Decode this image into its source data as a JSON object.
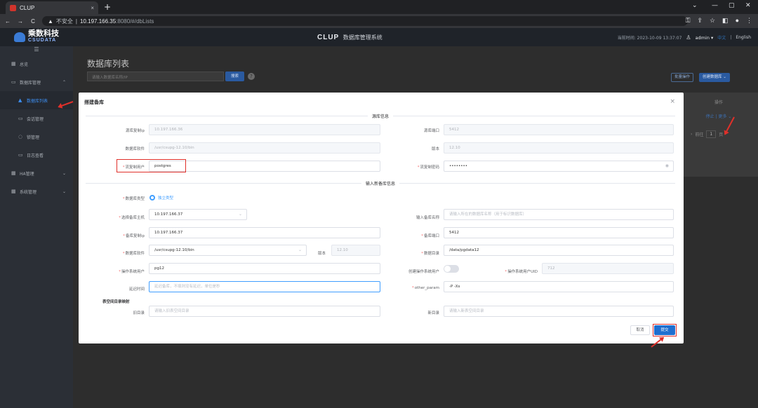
{
  "browser": {
    "tab_title": "CLUP",
    "tab_close": "×",
    "new_tab": "+",
    "back": "←",
    "forward": "→",
    "reload": "C",
    "insecure_label": "不安全",
    "url_host": "10.197.166.35",
    "url_rest": ":8080/#/dbLists",
    "window_controls": [
      "⌄",
      "—",
      "▢",
      "✕"
    ]
  },
  "header": {
    "logo_cn": "乘数科技",
    "logo_en": "CSUDATA",
    "brand": "CLUP",
    "app_title": "数据库管理系统",
    "time": "当前时间: 2023-10-09 13:37:07",
    "user": "admin ▾",
    "lang_cn": "中文",
    "lang_sep": "|",
    "lang_en": "English"
  },
  "sidebar": {
    "collapse": "☰",
    "items": [
      {
        "label": "总览",
        "icon": "▦"
      },
      {
        "label": "数据库管理",
        "icon": "▭",
        "chev": "⌃"
      },
      {
        "label": "数据库列表",
        "icon": "▲"
      },
      {
        "label": "会话管理",
        "icon": "▭"
      },
      {
        "label": "锁管理",
        "icon": "◌"
      },
      {
        "label": "日志查看",
        "icon": "▭"
      },
      {
        "label": "HA管理",
        "icon": "▦",
        "chev": "⌄"
      },
      {
        "label": "系统管理",
        "icon": "▦",
        "chev": "⌄"
      }
    ]
  },
  "page": {
    "title": "数据库列表",
    "search_placeholder": "请输入数据库名称/IP",
    "search_btn": "搜索",
    "help": "?",
    "batch_btn": "批量操作",
    "create_btn": "创建数据库 ⌄",
    "ops_header": "操作",
    "ops_links": "停止 | 更多 ⌄",
    "pager_prev": "›",
    "pager_goto": "前往",
    "pager_page": "1",
    "pager_unit": "页"
  },
  "modal": {
    "title": "搭建备库",
    "close": "×",
    "section_source": "源库信息",
    "section_new": "输入新备库信息",
    "src_ip_label": "源库复制ip",
    "src_ip": "10.197.166.36",
    "src_port_label": "源库端口",
    "src_port": "5412",
    "src_soft_label": "数据库软件",
    "src_soft": "/usr/csupg-12.10/bin",
    "version_label": "版本",
    "version": "12.10",
    "repl_user_label": "流复制用户",
    "repl_user": "postgres",
    "repl_pwd_label": "流复制密码",
    "repl_pwd": "••••••••",
    "eye": "◉",
    "db_type_label": "数据库类型",
    "db_type": "独立类型",
    "host_label": "选择备库主机",
    "host": "10.197.166.37",
    "db_name_label": "输入备库名称",
    "db_name_ph": "请输入所在的数据库名称（用于标识数据库）",
    "rep_ip_label": "备库复制ip",
    "rep_ip": "10.197.166.37",
    "rep_port_label": "备库端口",
    "rep_port": "5412",
    "soft_label": "数据库软件",
    "soft": "/usr/csupg-12.10/bin",
    "soft_ver_label": "版本",
    "soft_ver": "12.10",
    "data_dir_label": "数据目录",
    "data_dir": "/data/pgdata12",
    "os_user_label": "操作系统用户",
    "os_user": "pg12",
    "create_os_user_label": "创建操作系统用户",
    "uid_label": "操作系统用户UID",
    "uid": "712",
    "delay_label": "延迟时间",
    "delay_ph": "延迟备库，不填则没有延迟，单位是秒",
    "other_param_label": "other_param",
    "other_param": "-P -Xs",
    "tablespace_label": "表空间目录映射",
    "old_dir_label": "旧目录",
    "old_dir_ph": "请输入旧表空间目录",
    "new_dir_label": "新目录",
    "new_dir_ph": "请输入新表空间目录",
    "cancel": "取消",
    "submit": "提交",
    "select_arrow": "⌄"
  },
  "colors": {
    "primary": "#409eff",
    "highlight": "#e0302a",
    "submit": "#1f6fd0"
  }
}
